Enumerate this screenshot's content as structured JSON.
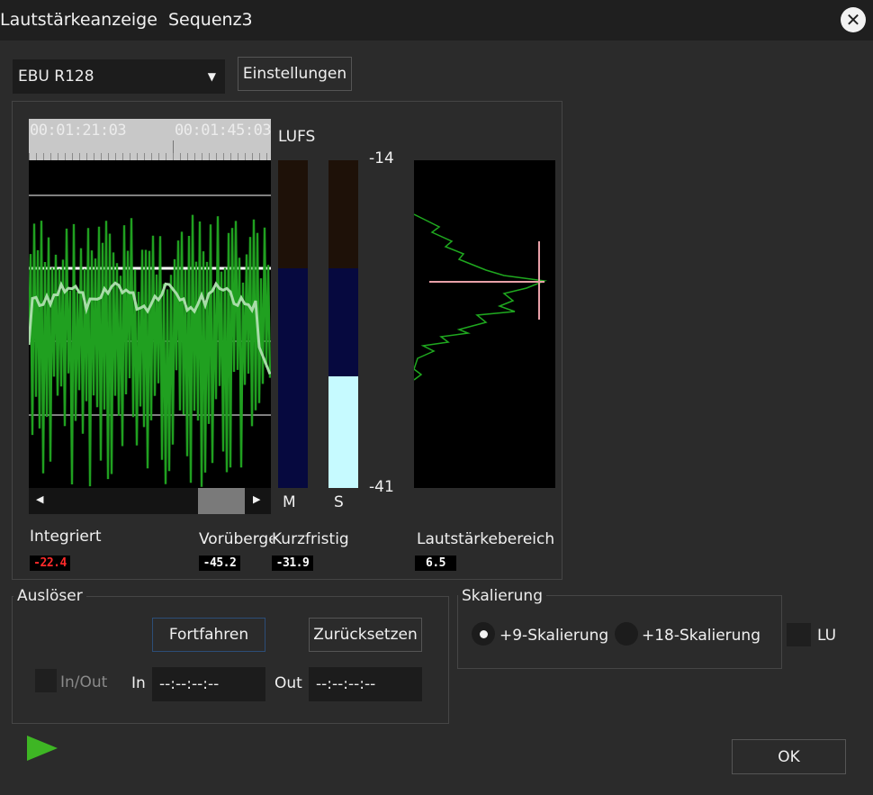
{
  "window": {
    "title": "Lautstärkeanzeige  Sequenz3"
  },
  "toolbar": {
    "standard_selected": "EBU R128",
    "settings_label": "Einstellungen"
  },
  "timeline": {
    "time_start": "00:01:21:03",
    "time_end": "00:01:45:03"
  },
  "meters": {
    "unit_label": "LUFS",
    "scale_max": "-14",
    "scale_min": "-41",
    "m_label": "M",
    "s_label": "S",
    "m_level_fraction": 0.67,
    "s_level_fraction": 0.34,
    "target_fraction": 0.67
  },
  "readouts": {
    "integrated_label": "Integriert",
    "integrated_value": "-22.4",
    "momentary_label": "Vorübergehend",
    "momentary_value": "-45.2",
    "shortterm_label": "Kurzfristig",
    "shortterm_value": "-31.9",
    "range_label": "Lautstärkebereich",
    "range_value": "6.5"
  },
  "trigger": {
    "group_label": "Auslöser",
    "continue_label": "Fortfahren",
    "reset_label": "Zurücksetzen",
    "inout_label": "In/Out",
    "in_label": "In",
    "in_value": "--:--:--:--",
    "out_label": "Out",
    "out_value": "--:--:--:--"
  },
  "scaling": {
    "group_label": "Skalierung",
    "option_9": "+9-Skalierung",
    "option_18": "+18-Skalierung",
    "selected": "+9-Skalierung",
    "lu_label": "LU"
  },
  "footer": {
    "ok_label": "OK"
  },
  "colors": {
    "accent_green": "#3eb624",
    "meter_fill": "#c6faff",
    "meter_blue": "#06093f",
    "meter_brown": "#1e1108",
    "integrated_red": "#ff2a2a",
    "histogram_marker": "#e8a0a8"
  }
}
